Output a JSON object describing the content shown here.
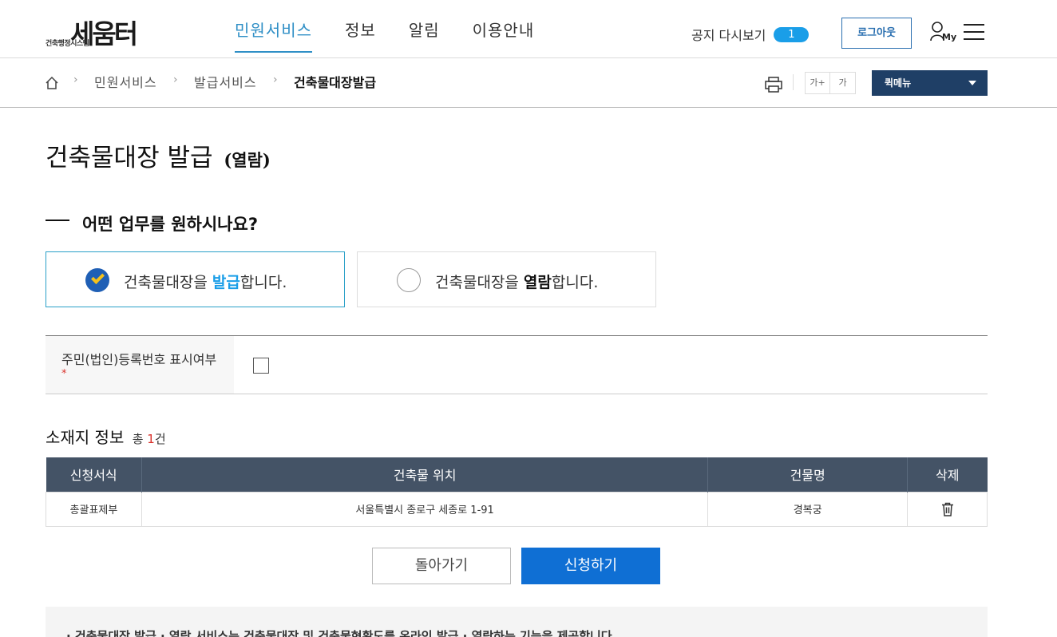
{
  "header": {
    "logo_main": "세움터",
    "logo_sub": "건축행정시스템",
    "nav": [
      "민원서비스",
      "정보",
      "알림",
      "이용안내"
    ],
    "notice_label": "공지 다시보기",
    "notice_count": "1",
    "logout_label": "로그아웃",
    "my_label": "My"
  },
  "breadcrumb": {
    "items": [
      "민원서비스",
      "발급서비스",
      "건축물대장발급"
    ],
    "font_up": "가+",
    "font_down": "가",
    "quick_menu": "퀵메뉴"
  },
  "page": {
    "title": "건축물대장 발급",
    "title_sub": "(열람)",
    "question": "어떤 업무를 원하시나요?"
  },
  "choices": [
    {
      "prefix": "건축물대장을 ",
      "keyword": "발급",
      "suffix": "합니다.",
      "selected": true
    },
    {
      "prefix": "건축물대장을 ",
      "keyword": "열람",
      "suffix": "합니다.",
      "selected": false
    }
  ],
  "form": {
    "rrn_label": "주민(법인)등록번호 표시여부",
    "required_mark": "*"
  },
  "location": {
    "title": "소재지 정보",
    "count_prefix": "총 ",
    "count": "1",
    "count_suffix": "건",
    "columns": [
      "신청서식",
      "건축물 위치",
      "건물명",
      "삭제"
    ],
    "rows": [
      {
        "form_type": "총괄표제부",
        "address": "서울특별시 종로구 세종로 1-91",
        "building": "경복궁"
      }
    ]
  },
  "buttons": {
    "back": "돌아가기",
    "apply": "신청하기"
  },
  "info": {
    "text": "· 건축물대장 발급 · 열람 서비스는 건축물대장 및 건축물현황도를 온라인 발급 · 열람하는 기능을 제공합니다."
  }
}
